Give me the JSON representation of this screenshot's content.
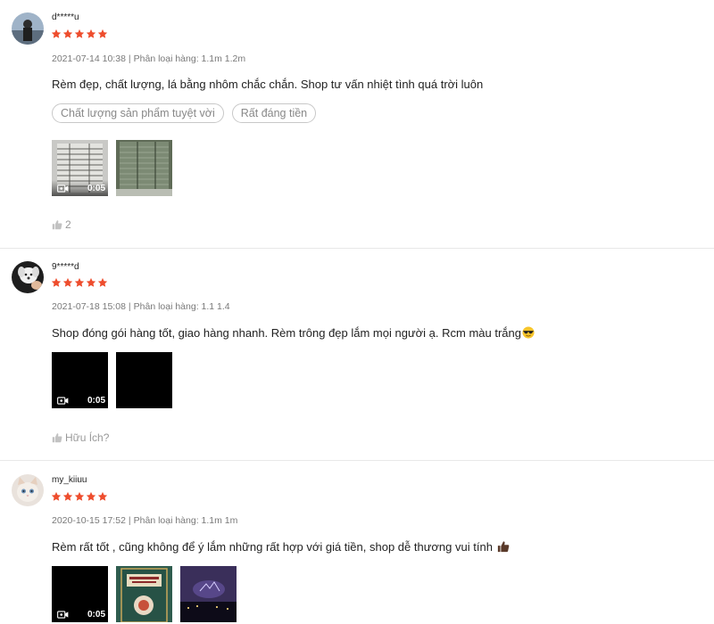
{
  "reviews": [
    {
      "author": "d*****u",
      "rating": 5,
      "date": "2021-07-14 10:38",
      "separator": "|",
      "variation": "Phân loại hàng: 1.1m 1.2m",
      "comment": "Rèm đẹp, chất lượng, lá bằng nhôm chắc chắn. Shop tư vấn nhiệt tình quá trời luôn",
      "tags": [
        "Chất lượng sản phẩm tuyệt vời",
        "Rất đáng tiền"
      ],
      "media": [
        {
          "type": "video",
          "duration": "0:05"
        },
        {
          "type": "image"
        }
      ],
      "helpful": "2"
    },
    {
      "author": "9*****d",
      "rating": 5,
      "date": "2021-07-18 15:08",
      "separator": "|",
      "variation": "Phân loại hàng: 1.1 1.4",
      "comment": "Shop đóng gói hàng tốt, giao hàng nhanh. Rèm trông đẹp lắm mọi người ạ. Rcm màu trắng",
      "media": [
        {
          "type": "video",
          "duration": "0:05"
        },
        {
          "type": "image"
        }
      ],
      "helpful": "Hữu Ích?"
    },
    {
      "author": "my_kiiuu",
      "rating": 5,
      "date": "2020-10-15 17:52",
      "separator": "|",
      "variation": "Phân loại hàng: 1.1m 1m",
      "comment": "Rèm rất tốt , cũng không để ý lắm những rất hợp với giá tiền, shop dễ thương vui tính",
      "media": [
        {
          "type": "video",
          "duration": "0:05"
        },
        {
          "type": "image"
        },
        {
          "type": "image"
        }
      ]
    }
  ],
  "colors": {
    "star": "#ee4d2d",
    "meta": "#8a8a8a",
    "divider": "#e8e8e8"
  },
  "icons": {
    "star": "star-icon",
    "video": "video-camera-icon",
    "like": "thumbs-up-icon"
  }
}
